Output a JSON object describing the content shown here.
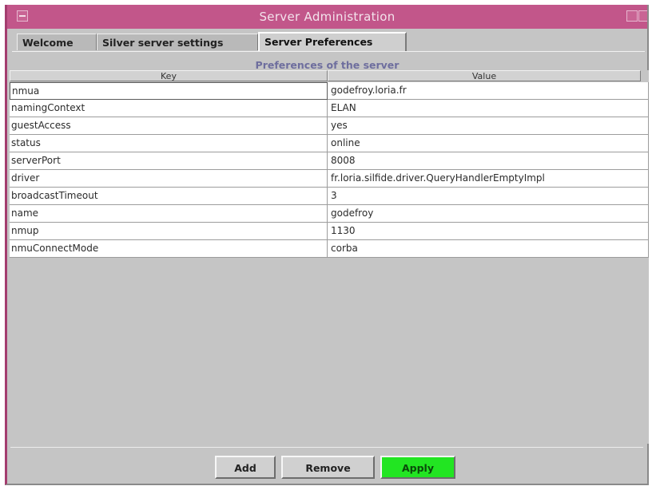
{
  "window": {
    "title": "Server Administration"
  },
  "tabs": [
    {
      "label": "Welcome",
      "active": false
    },
    {
      "label": "Silver server settings",
      "active": false
    },
    {
      "label": "Server Preferences",
      "active": true
    }
  ],
  "panel": {
    "title": "Preferences of the server"
  },
  "table": {
    "columns": [
      "Key",
      "Value"
    ],
    "rows": [
      {
        "key": "nmua",
        "value": "godefroy.loria.fr"
      },
      {
        "key": "namingContext",
        "value": "ELAN"
      },
      {
        "key": "guestAccess",
        "value": "yes"
      },
      {
        "key": "status",
        "value": "online"
      },
      {
        "key": "serverPort",
        "value": "8008"
      },
      {
        "key": "driver",
        "value": "fr.loria.silfide.driver.QueryHandlerEmptyImpl"
      },
      {
        "key": "broadcastTimeout",
        "value": "3"
      },
      {
        "key": "name",
        "value": "godefroy"
      },
      {
        "key": "nmup",
        "value": "1130"
      },
      {
        "key": "nmuConnectMode",
        "value": "corba"
      }
    ]
  },
  "buttons": {
    "add": "Add",
    "remove": "Remove",
    "apply": "Apply"
  },
  "colors": {
    "title_bar": "#c2568a",
    "apply_button": "#22e522",
    "window_bg": "#c5c5c5"
  }
}
